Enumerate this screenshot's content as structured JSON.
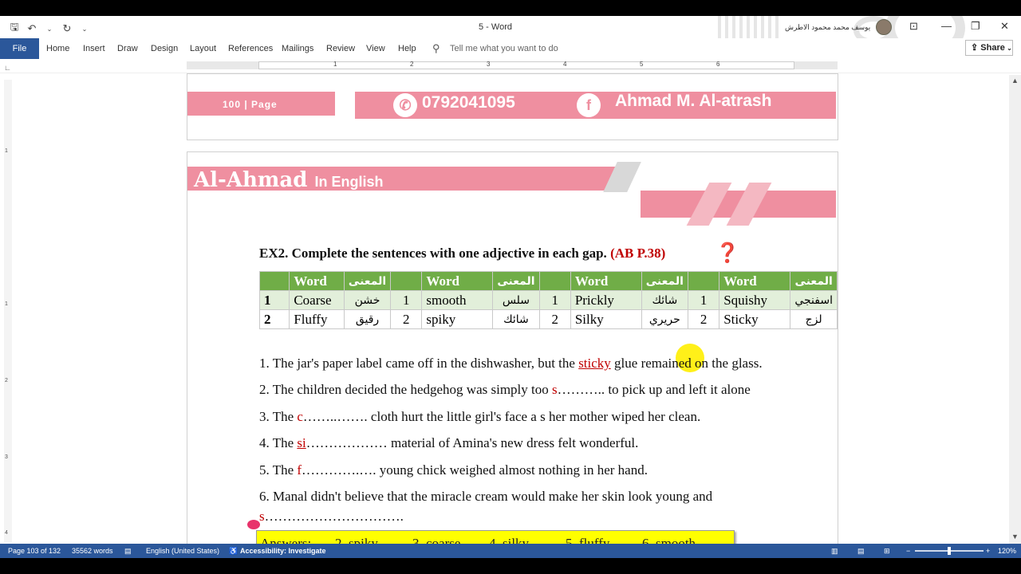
{
  "window": {
    "title": "5  -  Word",
    "user_name": "يوسف محمد محمود الاطرش"
  },
  "qat": {
    "save_icon": "save-icon",
    "undo_icon": "undo-icon",
    "redo_icon": "redo-icon"
  },
  "ribbon": {
    "tabs": [
      "File",
      "Home",
      "Insert",
      "Draw",
      "Design",
      "Layout",
      "References",
      "Mailings",
      "Review",
      "View",
      "Help"
    ],
    "tell_me_placeholder": "Tell me what you want to do",
    "share_label": "Share"
  },
  "ruler": {
    "numbers": [
      "1",
      "2",
      "3",
      "4",
      "5",
      "6"
    ]
  },
  "vruler": {
    "numbers": [
      "1",
      "1",
      "2",
      "3",
      "4"
    ]
  },
  "page_top": {
    "page_label": "100 | Page",
    "phone": "0792041095",
    "author": "Ahmad M. Al-atrash"
  },
  "page_main": {
    "banner_title": "Al-Ahmad",
    "banner_sub": "In English",
    "exercise_title": "EX2. Complete the sentences with one adjective in each gap.",
    "exercise_ref": "(AB P.38)",
    "table": {
      "header": {
        "word": "Word",
        "meaning": "المعنى"
      },
      "rows": [
        {
          "num": "1",
          "cells": [
            {
              "word": "Coarse",
              "ar": "خشن"
            },
            {
              "num": "1",
              "word": "smooth",
              "ar": "سلس"
            },
            {
              "num": "1",
              "word": "Prickly",
              "ar": "شائك"
            },
            {
              "num": "1",
              "word": "Squishy",
              "ar": "اسفنجي"
            }
          ]
        },
        {
          "num": "2",
          "cells": [
            {
              "word": "Fluffy",
              "ar": "رقيق"
            },
            {
              "num": "2",
              "word": "spiky",
              "ar": "شائك"
            },
            {
              "num": "2",
              "word": "Silky",
              "ar": "حريري"
            },
            {
              "num": "2",
              "word": "Sticky",
              "ar": "لزج"
            }
          ]
        }
      ]
    },
    "sentences": {
      "s1_pre": "1. The jar's paper label came off in the dishwasher, but the ",
      "s1_word": "sticky",
      "s1_post": " glue remained on the glass.",
      "s2_pre": "2. The children decided the hedgehog was simply too ",
      "s2_letter": "s",
      "s2_post": "……….. to pick up and left it alone",
      "s3_pre": "3. The ",
      "s3_letter": "c",
      "s3_post": "……..……. cloth hurt the little girl's face a s her mother wiped her clean.",
      "s4_pre": "4. The ",
      "s4_letter": "si",
      "s4_post": "……………… material of Amina's new dress felt wonderful.",
      "s5_pre": "5. The ",
      "s5_letter": "f",
      "s5_post": "………….…. young chick weighed almost nothing in her hand.",
      "s6_line1": "6. Manal didn't believe that the miracle cream would make her skin look young and",
      "s6_letter": "s",
      "s6_post": "…………………………."
    },
    "answers": {
      "label": "Answers:",
      "a2": "2. spiky",
      "a3": "3. coarse",
      "a4": "4. silky",
      "a5": "5. fluffy",
      "a6": "6. smooth"
    }
  },
  "status": {
    "page": "Page 103 of 132",
    "words": "35562 words",
    "language": "English (United States)",
    "accessibility": "Accessibility: Investigate",
    "zoom": "120%"
  },
  "colors": {
    "word_blue": "#2b579a",
    "banner_pink": "#ef8fa0",
    "table_green": "#70ad47",
    "answer_yellow": "#ffff00",
    "accent_red": "#c00000"
  }
}
